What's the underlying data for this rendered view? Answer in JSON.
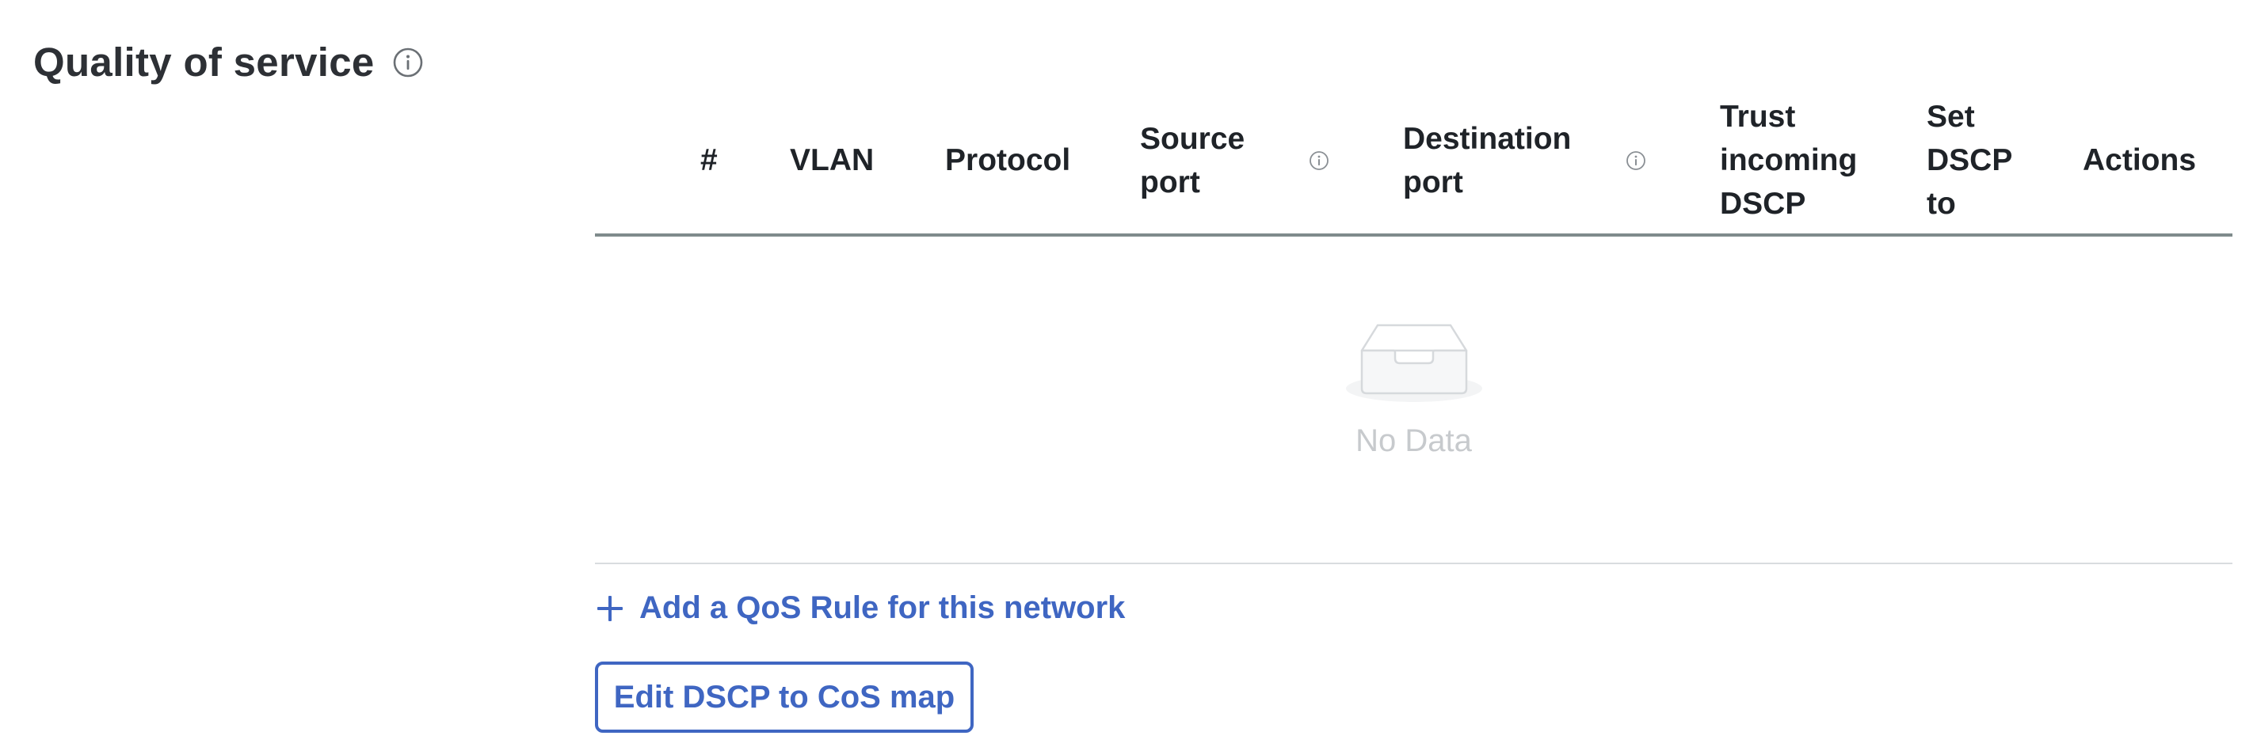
{
  "section": {
    "title": "Quality of service",
    "info_icon": "info-circle-icon"
  },
  "table": {
    "columns": [
      {
        "key": "hash",
        "lines": [
          "#"
        ]
      },
      {
        "key": "vlan",
        "lines": [
          "VLAN"
        ]
      },
      {
        "key": "protocol",
        "lines": [
          "Protocol"
        ]
      },
      {
        "key": "source_port",
        "lines": [
          "Source",
          "port"
        ],
        "info_icon": "info-circle-icon"
      },
      {
        "key": "destination_port",
        "lines": [
          "Destination",
          "port"
        ],
        "info_icon": "info-circle-icon"
      },
      {
        "key": "trust_dscp",
        "lines": [
          "Trust",
          "incoming",
          "DSCP"
        ]
      },
      {
        "key": "set_dscp",
        "lines": [
          "Set",
          "DSCP",
          "to"
        ]
      },
      {
        "key": "actions",
        "lines": [
          "Actions"
        ]
      }
    ],
    "rows": [],
    "empty_text": "No Data",
    "empty_icon": "empty-inbox-icon"
  },
  "actions": {
    "add_rule_label": "Add a QoS Rule for this network",
    "add_rule_icon": "plus-icon",
    "edit_map_label": "Edit DSCP to CoS map"
  },
  "colors": {
    "accent": "#3f66c2",
    "title": "#2d3035",
    "header_border": "#7f8b8c",
    "empty_text": "#c7cacd"
  }
}
